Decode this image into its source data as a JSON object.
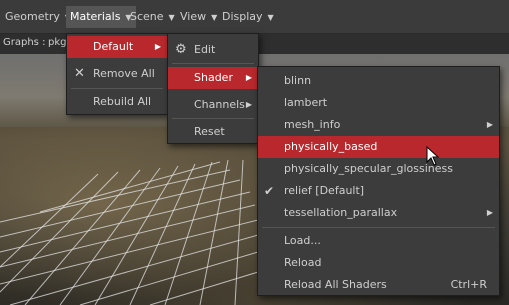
{
  "menubar": {
    "items": [
      {
        "label": "Geometry"
      },
      {
        "label": "Materials"
      },
      {
        "label": "Scene"
      },
      {
        "label": "View"
      },
      {
        "label": "Display"
      }
    ]
  },
  "graphs": {
    "label": "Graphs :",
    "value": "pkg:/"
  },
  "materials_menu": {
    "items": [
      {
        "label": "Default"
      },
      {
        "label": "Remove All"
      },
      {
        "label": "Rebuild All"
      }
    ]
  },
  "default_menu": {
    "items": [
      {
        "label": "Edit"
      },
      {
        "label": "Shader"
      },
      {
        "label": "Channels"
      },
      {
        "label": "Reset"
      }
    ]
  },
  "shader_menu": {
    "items": [
      {
        "label": "blinn"
      },
      {
        "label": "lambert"
      },
      {
        "label": "mesh_info"
      },
      {
        "label": "physically_based"
      },
      {
        "label": "physically_specular_glossiness"
      },
      {
        "label": "relief [Default]"
      },
      {
        "label": "tessellation_parallax"
      },
      {
        "label": "Load..."
      },
      {
        "label": "Reload"
      },
      {
        "label": "Reload All Shaders",
        "shortcut": "Ctrl+R"
      }
    ],
    "highlighted": "physically_based",
    "checked": "relief [Default]"
  },
  "colors": {
    "highlight": "#b8282c",
    "menu_bg": "#3c3c3c"
  }
}
